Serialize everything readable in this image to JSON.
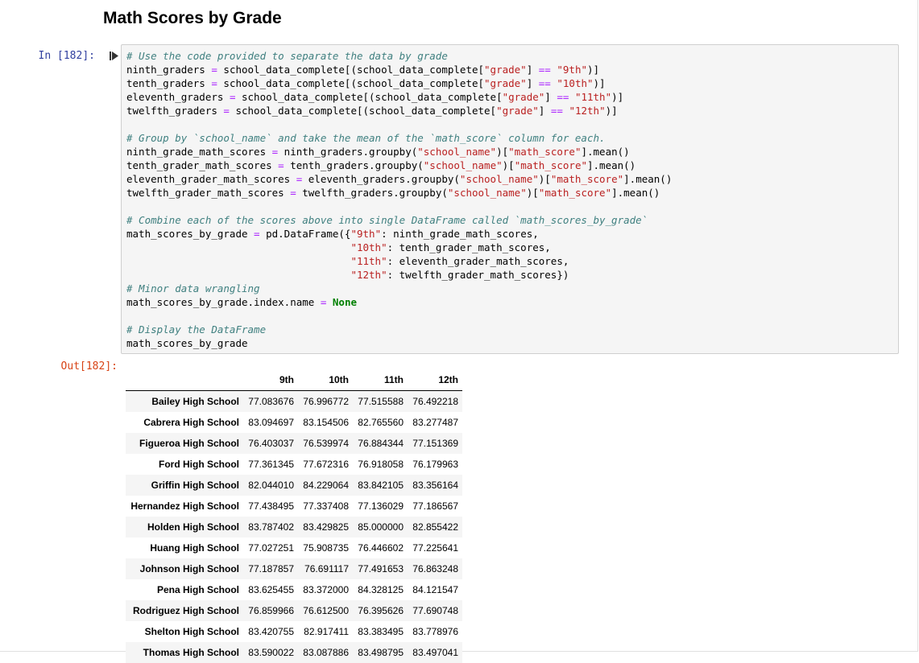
{
  "section": {
    "title": "Math Scores by Grade"
  },
  "cell": {
    "in_prompt": "In [182]:",
    "out_prompt": "Out[182]:",
    "run_icon": "run-cell-icon"
  },
  "code_lines": [
    [
      {
        "t": "# Use the code provided to separate the data by grade",
        "c": "cm"
      }
    ],
    [
      {
        "t": "ninth_graders "
      },
      {
        "t": "=",
        "c": "op"
      },
      {
        "t": " school_data_complete[(school_data_complete["
      },
      {
        "t": "\"grade\"",
        "c": "st"
      },
      {
        "t": "] "
      },
      {
        "t": "==",
        "c": "op"
      },
      {
        "t": " "
      },
      {
        "t": "\"9th\"",
        "c": "st"
      },
      {
        "t": ")]"
      }
    ],
    [
      {
        "t": "tenth_graders "
      },
      {
        "t": "=",
        "c": "op"
      },
      {
        "t": " school_data_complete[(school_data_complete["
      },
      {
        "t": "\"grade\"",
        "c": "st"
      },
      {
        "t": "] "
      },
      {
        "t": "==",
        "c": "op"
      },
      {
        "t": " "
      },
      {
        "t": "\"10th\"",
        "c": "st"
      },
      {
        "t": ")]"
      }
    ],
    [
      {
        "t": "eleventh_graders "
      },
      {
        "t": "=",
        "c": "op"
      },
      {
        "t": " school_data_complete[(school_data_complete["
      },
      {
        "t": "\"grade\"",
        "c": "st"
      },
      {
        "t": "] "
      },
      {
        "t": "==",
        "c": "op"
      },
      {
        "t": " "
      },
      {
        "t": "\"11th\"",
        "c": "st"
      },
      {
        "t": ")]"
      }
    ],
    [
      {
        "t": "twelfth_graders "
      },
      {
        "t": "=",
        "c": "op"
      },
      {
        "t": " school_data_complete[(school_data_complete["
      },
      {
        "t": "\"grade\"",
        "c": "st"
      },
      {
        "t": "] "
      },
      {
        "t": "==",
        "c": "op"
      },
      {
        "t": " "
      },
      {
        "t": "\"12th\"",
        "c": "st"
      },
      {
        "t": ")]"
      }
    ],
    [],
    [
      {
        "t": "# Group by `school_name` and take the mean of the `math_score` column for each.",
        "c": "cm"
      }
    ],
    [
      {
        "t": "ninth_grade_math_scores "
      },
      {
        "t": "=",
        "c": "op"
      },
      {
        "t": " ninth_graders.groupby("
      },
      {
        "t": "\"school_name\"",
        "c": "st"
      },
      {
        "t": ")["
      },
      {
        "t": "\"math_score\"",
        "c": "st"
      },
      {
        "t": "].mean()"
      }
    ],
    [
      {
        "t": "tenth_grader_math_scores "
      },
      {
        "t": "=",
        "c": "op"
      },
      {
        "t": " tenth_graders.groupby("
      },
      {
        "t": "\"school_name\"",
        "c": "st"
      },
      {
        "t": ")["
      },
      {
        "t": "\"math_score\"",
        "c": "st"
      },
      {
        "t": "].mean()"
      }
    ],
    [
      {
        "t": "eleventh_grader_math_scores "
      },
      {
        "t": "=",
        "c": "op"
      },
      {
        "t": " eleventh_graders.groupby("
      },
      {
        "t": "\"school_name\"",
        "c": "st"
      },
      {
        "t": ")["
      },
      {
        "t": "\"math_score\"",
        "c": "st"
      },
      {
        "t": "].mean()"
      }
    ],
    [
      {
        "t": "twelfth_grader_math_scores "
      },
      {
        "t": "=",
        "c": "op"
      },
      {
        "t": " twelfth_graders.groupby("
      },
      {
        "t": "\"school_name\"",
        "c": "st"
      },
      {
        "t": ")["
      },
      {
        "t": "\"math_score\"",
        "c": "st"
      },
      {
        "t": "].mean()"
      }
    ],
    [],
    [
      {
        "t": "# Combine each of the scores above into single DataFrame called `math_scores_by_grade`",
        "c": "cm"
      }
    ],
    [
      {
        "t": "math_scores_by_grade "
      },
      {
        "t": "=",
        "c": "op"
      },
      {
        "t": " pd.DataFrame({"
      },
      {
        "t": "\"9th\"",
        "c": "st"
      },
      {
        "t": ": ninth_grade_math_scores,"
      }
    ],
    [
      {
        "t": "                                     "
      },
      {
        "t": "\"10th\"",
        "c": "st"
      },
      {
        "t": ": tenth_grader_math_scores,"
      }
    ],
    [
      {
        "t": "                                     "
      },
      {
        "t": "\"11th\"",
        "c": "st"
      },
      {
        "t": ": eleventh_grader_math_scores,"
      }
    ],
    [
      {
        "t": "                                     "
      },
      {
        "t": "\"12th\"",
        "c": "st"
      },
      {
        "t": ": twelfth_grader_math_scores})"
      }
    ],
    [
      {
        "t": "# Minor data wrangling",
        "c": "cm"
      }
    ],
    [
      {
        "t": "math_scores_by_grade.index.name "
      },
      {
        "t": "=",
        "c": "op"
      },
      {
        "t": " "
      },
      {
        "t": "None",
        "c": "kw"
      }
    ],
    [],
    [
      {
        "t": "# Display the DataFrame",
        "c": "cm"
      }
    ],
    [
      {
        "t": "math_scores_by_grade"
      }
    ]
  ],
  "table": {
    "columns": [
      "",
      "9th",
      "10th",
      "11th",
      "12th"
    ],
    "rows": [
      [
        "Bailey High School",
        "77.083676",
        "76.996772",
        "77.515588",
        "76.492218"
      ],
      [
        "Cabrera High School",
        "83.094697",
        "83.154506",
        "82.765560",
        "83.277487"
      ],
      [
        "Figueroa High School",
        "76.403037",
        "76.539974",
        "76.884344",
        "77.151369"
      ],
      [
        "Ford High School",
        "77.361345",
        "77.672316",
        "76.918058",
        "76.179963"
      ],
      [
        "Griffin High School",
        "82.044010",
        "84.229064",
        "83.842105",
        "83.356164"
      ],
      [
        "Hernandez High School",
        "77.438495",
        "77.337408",
        "77.136029",
        "77.186567"
      ],
      [
        "Holden High School",
        "83.787402",
        "83.429825",
        "85.000000",
        "82.855422"
      ],
      [
        "Huang High School",
        "77.027251",
        "75.908735",
        "76.446602",
        "77.225641"
      ],
      [
        "Johnson High School",
        "77.187857",
        "76.691117",
        "77.491653",
        "76.863248"
      ],
      [
        "Pena High School",
        "83.625455",
        "83.372000",
        "84.328125",
        "84.121547"
      ],
      [
        "Rodriguez High School",
        "76.859966",
        "76.612500",
        "76.395626",
        "77.690748"
      ],
      [
        "Shelton High School",
        "83.420755",
        "82.917411",
        "83.383495",
        "83.778976"
      ],
      [
        "Thomas High School",
        "83.590022",
        "83.087886",
        "83.498795",
        "83.497041"
      ]
    ]
  },
  "colors": {
    "comment": "#408080",
    "string": "#ba2121",
    "operator": "#aa22ff",
    "keyword": "#008000",
    "in_prompt": "#303f9f",
    "out_prompt": "#d84315"
  }
}
